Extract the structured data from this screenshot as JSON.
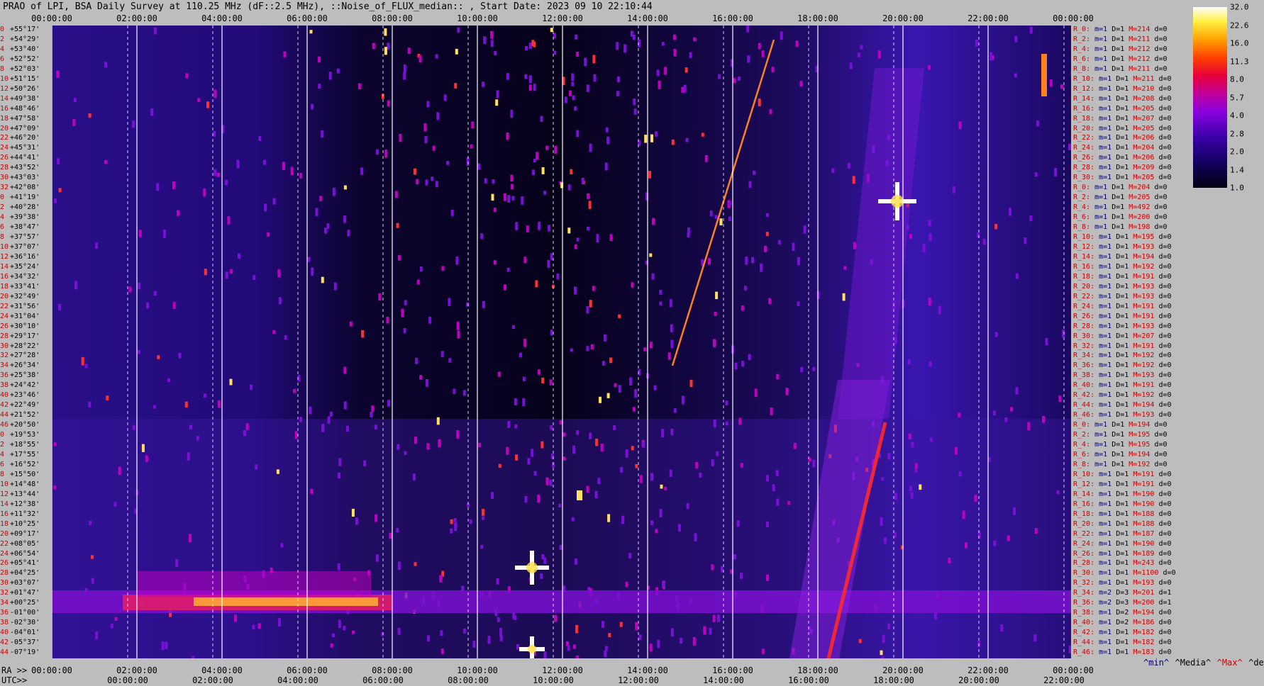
{
  "title": "PRAO of LPI, BSA Daily Survey at 110.25 MHz (dF::2.5 MHz), ::Noise_of_FLUX_median:: , Start Date: 2023 09 10 22:10:44",
  "chart_data": {
    "type": "heatmap",
    "title": "PRAO of LPI, BSA Daily Survey at 110.25 MHz (dF::2.5 MHz), ::Noise_of_FLUX_median:: , Start Date: 2023 09 10 22:10:44",
    "x_top_ticks": [
      "00:00:00",
      "02:00:00",
      "04:00:00",
      "06:00:00",
      "08:00:00",
      "10:00:00",
      "12:00:00",
      "14:00:00",
      "16:00:00",
      "18:00:00",
      "20:00:00",
      "22:00:00",
      "00:00:00"
    ],
    "x_bottom_ra_prefix": "RA >>",
    "x_bottom_ra_ticks": [
      "00:00:00",
      "02:00:00",
      "04:00:00",
      "06:00:00",
      "08:00:00",
      "10:00:00",
      "12:00:00",
      "14:00:00",
      "16:00:00",
      "18:00:00",
      "20:00:00",
      "22:00:00",
      "00:00:00"
    ],
    "x_bottom_utc_prefix": "UTC>>",
    "x_bottom_utc_ticks": [
      "00:00:00",
      "02:00:00",
      "04:00:00",
      "06:00:00",
      "08:00:00",
      "10:00:00",
      "12:00:00",
      "14:00:00",
      "16:00:00",
      "18:00:00",
      "20:00:00",
      "22:00:00"
    ],
    "declination_labels": [
      {
        "i": "0",
        "v": "+55°17'"
      },
      {
        "i": "2",
        "v": "+54°29'"
      },
      {
        "i": "4",
        "v": "+53°40'"
      },
      {
        "i": "6",
        "v": "+52°52'"
      },
      {
        "i": "8",
        "v": "+52°03'"
      },
      {
        "i": "10",
        "v": "+51°15'"
      },
      {
        "i": "12",
        "v": "+50°26'"
      },
      {
        "i": "14",
        "v": "+49°38'"
      },
      {
        "i": "16",
        "v": "+48°46'"
      },
      {
        "i": "18",
        "v": "+47°58'"
      },
      {
        "i": "20",
        "v": "+47°09'"
      },
      {
        "i": "22",
        "v": "+46°20'"
      },
      {
        "i": "24",
        "v": "+45°31'"
      },
      {
        "i": "26",
        "v": "+44°41'"
      },
      {
        "i": "28",
        "v": "+43°52'"
      },
      {
        "i": "30",
        "v": "+43°03'"
      },
      {
        "i": "32",
        "v": "+42°08'"
      },
      {
        "i": "0",
        "v": "+41°19'"
      },
      {
        "i": "2",
        "v": "+40°28'"
      },
      {
        "i": "4",
        "v": "+39°38'"
      },
      {
        "i": "6",
        "v": "+38°47'"
      },
      {
        "i": "8",
        "v": "+37°57'"
      },
      {
        "i": "10",
        "v": "+37°07'"
      },
      {
        "i": "12",
        "v": "+36°16'"
      },
      {
        "i": "14",
        "v": "+35°24'"
      },
      {
        "i": "16",
        "v": "+34°32'"
      },
      {
        "i": "18",
        "v": "+33°41'"
      },
      {
        "i": "20",
        "v": "+32°49'"
      },
      {
        "i": "22",
        "v": "+31°56'"
      },
      {
        "i": "24",
        "v": "+31°04'"
      },
      {
        "i": "26",
        "v": "+30°10'"
      },
      {
        "i": "28",
        "v": "+29°17'"
      },
      {
        "i": "30",
        "v": "+28°22'"
      },
      {
        "i": "32",
        "v": "+27°28'"
      },
      {
        "i": "34",
        "v": "+26°34'"
      },
      {
        "i": "36",
        "v": "+25°38'"
      },
      {
        "i": "38",
        "v": "+24°42'"
      },
      {
        "i": "40",
        "v": "+23°46'"
      },
      {
        "i": "42",
        "v": "+22°49'"
      },
      {
        "i": "44",
        "v": "+21°52'"
      },
      {
        "i": "46",
        "v": "+20°50'"
      },
      {
        "i": "0",
        "v": "+19°53'"
      },
      {
        "i": "2",
        "v": "+18°55'"
      },
      {
        "i": "4",
        "v": "+17°55'"
      },
      {
        "i": "6",
        "v": "+16°52'"
      },
      {
        "i": "8",
        "v": "+15°50'"
      },
      {
        "i": "10",
        "v": "+14°48'"
      },
      {
        "i": "12",
        "v": "+13°44'"
      },
      {
        "i": "14",
        "v": "+12°38'"
      },
      {
        "i": "16",
        "v": "+11°32'"
      },
      {
        "i": "18",
        "v": "+10°25'"
      },
      {
        "i": "20",
        "v": "+09°17'"
      },
      {
        "i": "22",
        "v": "+08°05'"
      },
      {
        "i": "24",
        "v": "+06°54'"
      },
      {
        "i": "26",
        "v": "+05°41'"
      },
      {
        "i": "28",
        "v": "+04°25'"
      },
      {
        "i": "30",
        "v": "+03°07'"
      },
      {
        "i": "32",
        "v": "+01°47'"
      },
      {
        "i": "34",
        "v": "+00°25'"
      },
      {
        "i": "36",
        "v": "-01°00'"
      },
      {
        "i": "38",
        "v": "-02°30'"
      },
      {
        "i": "40",
        "v": "-04°01'"
      },
      {
        "i": "42",
        "v": "-05°37'"
      },
      {
        "i": "44",
        "v": "-07°19'"
      }
    ],
    "colorbar": {
      "labels": [
        "32.0",
        "22.6",
        "16.0",
        "11.3",
        "8.0",
        "5.7",
        "4.0",
        "2.8",
        "2.0",
        "1.4",
        "1.0"
      ],
      "scale": "log"
    },
    "stats_rows": [
      {
        "r": "R_0:",
        "m": "1",
        "D": "1",
        "M": "214",
        "d": "0"
      },
      {
        "r": "R_2:",
        "m": "1",
        "D": "1",
        "M": "211",
        "d": "0"
      },
      {
        "r": "R_4:",
        "m": "1",
        "D": "1",
        "M": "212",
        "d": "0"
      },
      {
        "r": "R_6:",
        "m": "1",
        "D": "1",
        "M": "212",
        "d": "0"
      },
      {
        "r": "R_8:",
        "m": "1",
        "D": "1",
        "M": "211",
        "d": "0"
      },
      {
        "r": "R_10:",
        "m": "1",
        "D": "1",
        "M": "211",
        "d": "0"
      },
      {
        "r": "R_12:",
        "m": "1",
        "D": "1",
        "M": "210",
        "d": "0"
      },
      {
        "r": "R_14:",
        "m": "1",
        "D": "1",
        "M": "208",
        "d": "0"
      },
      {
        "r": "R_16:",
        "m": "1",
        "D": "1",
        "M": "205",
        "d": "0"
      },
      {
        "r": "R_18:",
        "m": "1",
        "D": "1",
        "M": "207",
        "d": "0"
      },
      {
        "r": "R_20:",
        "m": "1",
        "D": "1",
        "M": "205",
        "d": "0"
      },
      {
        "r": "R_22:",
        "m": "1",
        "D": "1",
        "M": "206",
        "d": "0"
      },
      {
        "r": "R_24:",
        "m": "1",
        "D": "1",
        "M": "204",
        "d": "0"
      },
      {
        "r": "R_26:",
        "m": "1",
        "D": "1",
        "M": "206",
        "d": "0"
      },
      {
        "r": "R_28:",
        "m": "1",
        "D": "1",
        "M": "209",
        "d": "0"
      },
      {
        "r": "R_30:",
        "m": "1",
        "D": "1",
        "M": "205",
        "d": "0"
      },
      {
        "r": "R_0:",
        "m": "1",
        "D": "1",
        "M": "204",
        "d": "0"
      },
      {
        "r": "R_2:",
        "m": "1",
        "D": "1",
        "M": "205",
        "d": "0"
      },
      {
        "r": "R_4:",
        "m": "1",
        "D": "1",
        "M": "492",
        "d": "0"
      },
      {
        "r": "R_6:",
        "m": "1",
        "D": "1",
        "M": "200",
        "d": "0"
      },
      {
        "r": "R_8:",
        "m": "1",
        "D": "1",
        "M": "198",
        "d": "0"
      },
      {
        "r": "R_10:",
        "m": "1",
        "D": "1",
        "M": "195",
        "d": "0"
      },
      {
        "r": "R_12:",
        "m": "1",
        "D": "1",
        "M": "193",
        "d": "0"
      },
      {
        "r": "R_14:",
        "m": "1",
        "D": "1",
        "M": "194",
        "d": "0"
      },
      {
        "r": "R_16:",
        "m": "1",
        "D": "1",
        "M": "192",
        "d": "0"
      },
      {
        "r": "R_18:",
        "m": "1",
        "D": "1",
        "M": "191",
        "d": "0"
      },
      {
        "r": "R_20:",
        "m": "1",
        "D": "1",
        "M": "193",
        "d": "0"
      },
      {
        "r": "R_22:",
        "m": "1",
        "D": "1",
        "M": "193",
        "d": "0"
      },
      {
        "r": "R_24:",
        "m": "1",
        "D": "1",
        "M": "191",
        "d": "0"
      },
      {
        "r": "R_26:",
        "m": "1",
        "D": "1",
        "M": "191",
        "d": "0"
      },
      {
        "r": "R_28:",
        "m": "1",
        "D": "1",
        "M": "193",
        "d": "0"
      },
      {
        "r": "R_30:",
        "m": "1",
        "D": "1",
        "M": "207",
        "d": "0"
      },
      {
        "r": "R_32:",
        "m": "1",
        "D": "1",
        "M": "191",
        "d": "0"
      },
      {
        "r": "R_34:",
        "m": "1",
        "D": "1",
        "M": "192",
        "d": "0"
      },
      {
        "r": "R_36:",
        "m": "1",
        "D": "1",
        "M": "192",
        "d": "0"
      },
      {
        "r": "R_38:",
        "m": "1",
        "D": "1",
        "M": "193",
        "d": "0"
      },
      {
        "r": "R_40:",
        "m": "1",
        "D": "1",
        "M": "191",
        "d": "0"
      },
      {
        "r": "R_42:",
        "m": "1",
        "D": "1",
        "M": "192",
        "d": "0"
      },
      {
        "r": "R_44:",
        "m": "1",
        "D": "1",
        "M": "194",
        "d": "0"
      },
      {
        "r": "R_46:",
        "m": "1",
        "D": "1",
        "M": "193",
        "d": "0"
      },
      {
        "r": "R_0:",
        "m": "1",
        "D": "1",
        "M": "194",
        "d": "0"
      },
      {
        "r": "R_2:",
        "m": "1",
        "D": "1",
        "M": "195",
        "d": "0"
      },
      {
        "r": "R_4:",
        "m": "1",
        "D": "1",
        "M": "195",
        "d": "0"
      },
      {
        "r": "R_6:",
        "m": "1",
        "D": "1",
        "M": "194",
        "d": "0"
      },
      {
        "r": "R_8:",
        "m": "1",
        "D": "1",
        "M": "192",
        "d": "0"
      },
      {
        "r": "R_10:",
        "m": "1",
        "D": "1",
        "M": "191",
        "d": "0"
      },
      {
        "r": "R_12:",
        "m": "1",
        "D": "1",
        "M": "191",
        "d": "0"
      },
      {
        "r": "R_14:",
        "m": "1",
        "D": "1",
        "M": "190",
        "d": "0"
      },
      {
        "r": "R_16:",
        "m": "1",
        "D": "1",
        "M": "190",
        "d": "0"
      },
      {
        "r": "R_18:",
        "m": "1",
        "D": "1",
        "M": "188",
        "d": "0"
      },
      {
        "r": "R_20:",
        "m": "1",
        "D": "1",
        "M": "188",
        "d": "0"
      },
      {
        "r": "R_22:",
        "m": "1",
        "D": "1",
        "M": "187",
        "d": "0"
      },
      {
        "r": "R_24:",
        "m": "1",
        "D": "1",
        "M": "190",
        "d": "0"
      },
      {
        "r": "R_26:",
        "m": "1",
        "D": "1",
        "M": "189",
        "d": "0"
      },
      {
        "r": "R_28:",
        "m": "1",
        "D": "1",
        "M": "243",
        "d": "0"
      },
      {
        "r": "R_30:",
        "m": "1",
        "D": "1",
        "M": "1100",
        "d": "0"
      },
      {
        "r": "R_32:",
        "m": "1",
        "D": "1",
        "M": "193",
        "d": "0"
      },
      {
        "r": "R_34:",
        "m": "2",
        "D": "3",
        "M": "201",
        "d": "1"
      },
      {
        "r": "R_36:",
        "m": "2",
        "D": "3",
        "M": "200",
        "d": "1"
      },
      {
        "r": "R_38:",
        "m": "1",
        "D": "2",
        "M": "194",
        "d": "0"
      },
      {
        "r": "R_40:",
        "m": "1",
        "D": "2",
        "M": "186",
        "d": "0"
      },
      {
        "r": "R_42:",
        "m": "1",
        "D": "1",
        "M": "182",
        "d": "0"
      },
      {
        "r": "R_44:",
        "m": "1",
        "D": "1",
        "M": "182",
        "d": "0"
      },
      {
        "r": "R_46:",
        "m": "1",
        "D": "1",
        "M": "183",
        "d": "0"
      }
    ],
    "stat_keys": {
      "m": "m=",
      "D": "D=",
      "M": "M=",
      "d": "d="
    },
    "legend": [
      {
        "text": "^min^",
        "color": "#00006a"
      },
      {
        "text": "^Media^",
        "color": "#000000"
      },
      {
        "text": "^Max^",
        "color": "#d00000"
      },
      {
        "text": "^devia^",
        "color": "#000000"
      }
    ]
  }
}
